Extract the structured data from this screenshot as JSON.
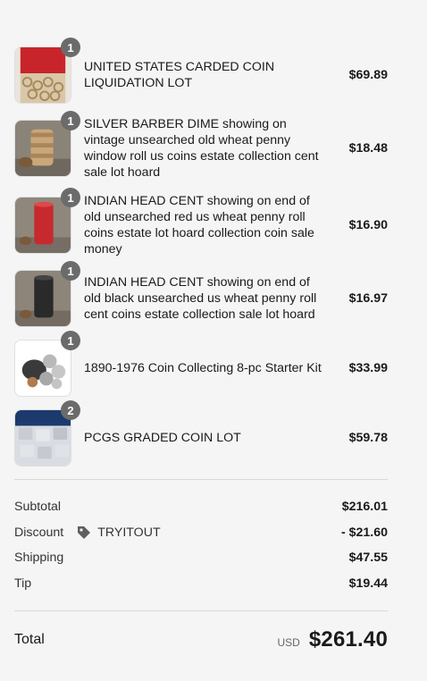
{
  "items": [
    {
      "quantity": "1",
      "title": "UNITED STATES CARDED COIN LIQUIDATION LOT",
      "price": "$69.89"
    },
    {
      "quantity": "1",
      "title": "SILVER BARBER DIME showing on vintage unsearched old wheat penny window roll us coins estate collection cent sale lot hoard",
      "price": "$18.48"
    },
    {
      "quantity": "1",
      "title": "INDIAN HEAD CENT showing on end of old unsearched red us wheat penny roll coins estate lot hoard collection coin sale money",
      "price": "$16.90"
    },
    {
      "quantity": "1",
      "title": "INDIAN HEAD CENT showing on end of old black unsearched us wheat penny roll cent coins estate collection sale lot hoard",
      "price": "$16.97"
    },
    {
      "quantity": "1",
      "title": "1890-1976 Coin Collecting 8-pc Starter Kit",
      "price": "$33.99"
    },
    {
      "quantity": "2",
      "title": "PCGS GRADED COIN LOT",
      "price": "$59.78"
    }
  ],
  "totals": {
    "subtotal_label": "Subtotal",
    "subtotal_value": "$216.01",
    "discount_label": "Discount",
    "discount_code": "TRYITOUT",
    "discount_value": "- $21.60",
    "shipping_label": "Shipping",
    "shipping_value": "$47.55",
    "tip_label": "Tip",
    "tip_value": "$19.44",
    "total_label": "Total",
    "currency": "USD",
    "total_value": "$261.40"
  }
}
